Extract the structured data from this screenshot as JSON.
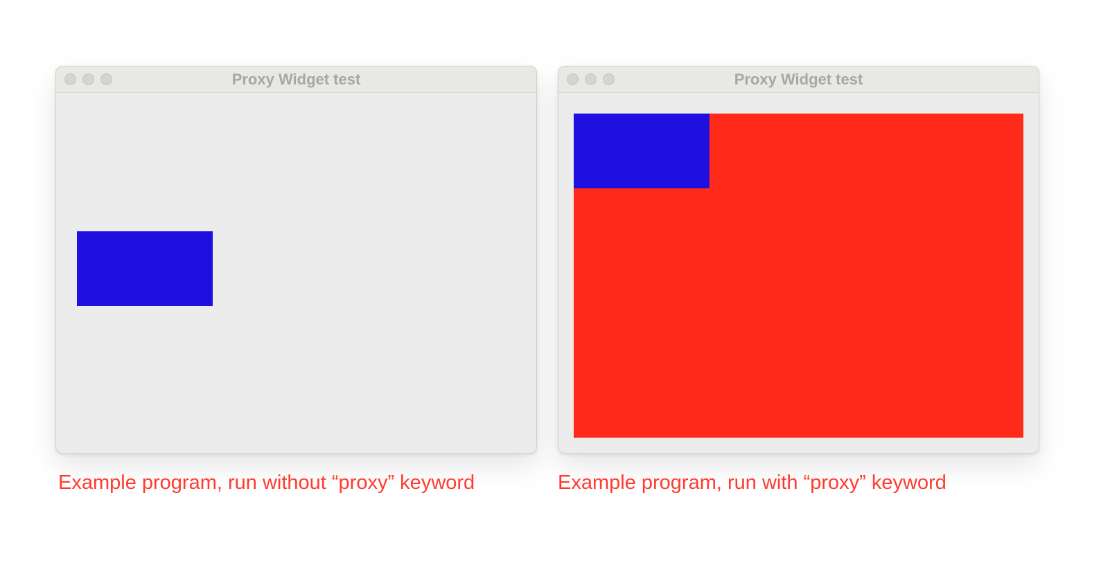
{
  "windows": {
    "left": {
      "title": "Proxy Widget test",
      "caption": "Example program, run without “proxy” keyword"
    },
    "right": {
      "title": "Proxy Widget test",
      "caption": "Example program, run with “proxy” keyword"
    }
  },
  "colors": {
    "blue": "#1f10e0",
    "red": "#ff2a1a",
    "captionText": "#ff3b2f",
    "windowChrome": "#e9e8e4",
    "windowBody": "#ececec"
  }
}
